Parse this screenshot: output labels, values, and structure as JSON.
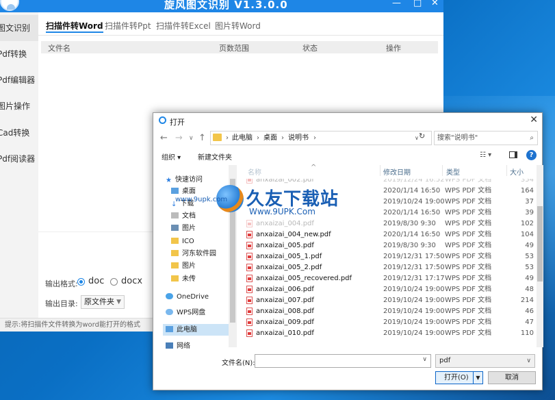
{
  "app": {
    "title": "旋风图文识别 V1.3.0.0",
    "window_controls": [
      "—",
      "□",
      "✕"
    ],
    "sidebar": [
      "图文识别",
      "Pdf转换",
      "Pdf编辑器",
      "图片操作",
      "Cad转换",
      "Pdf阅读器"
    ],
    "tabs": [
      "扫描件转Word",
      "扫描件转Ppt",
      "扫描件转Excel",
      "图片转Word"
    ],
    "table_headers": [
      "文件名",
      "页数范围",
      "状态",
      "操作"
    ],
    "output_format_label": "输出格式:",
    "format_options": [
      "doc",
      "docx"
    ],
    "selected_format": "doc",
    "output_dir_label": "输出目录:",
    "output_dir_value": "原文件夹",
    "status_text": "提示:将扫描件文件转换为word能打开的格式"
  },
  "dialog": {
    "title": "打开",
    "path": [
      "此电脑",
      "桌面",
      "说明书"
    ],
    "search_placeholder": "搜索\"说明书\"",
    "toolbar": {
      "organize": "组织 ▾",
      "new_folder": "新建文件夹"
    },
    "nav_items": [
      {
        "label": "快速访问",
        "icon": "star-icon"
      },
      {
        "label": "桌面",
        "icon": "folder-icon"
      },
      {
        "label": "下载",
        "icon": "download-icon"
      },
      {
        "label": "文档",
        "icon": "folder-icon"
      },
      {
        "label": "图片",
        "icon": "folder-icon"
      },
      {
        "label": "ICO",
        "icon": "folder-icon"
      },
      {
        "label": "河东软件园",
        "icon": "folder-icon"
      },
      {
        "label": "图片",
        "icon": "folder-icon"
      },
      {
        "label": "未传",
        "icon": "folder-icon"
      },
      {
        "label": "OneDrive",
        "icon": "cloud-icon"
      },
      {
        "label": "WPS网盘",
        "icon": "cloud-icon"
      },
      {
        "label": "此电脑",
        "icon": "pc-icon"
      },
      {
        "label": "网络",
        "icon": "network-icon"
      }
    ],
    "columns": [
      "名称",
      "修改日期",
      "类型",
      "大小"
    ],
    "files": [
      {
        "name": "anxaizai_002.pdf",
        "date": "2019/12/24 16:52",
        "type": "WPS PDF 文档",
        "size": "354",
        "faded": true
      },
      {
        "name": "anxaizai_003.pdf",
        "date": "2020/1/14 16:50",
        "type": "WPS PDF 文档",
        "size": "164",
        "faded": true
      },
      {
        "name": "anxaizai_003_1.pdf",
        "date": "2019/10/24 19:00",
        "type": "WPS PDF 文档",
        "size": "37",
        "faded": true
      },
      {
        "name": "anxaizai_004.pdf",
        "date": "2020/1/14 16:50",
        "type": "WPS PDF 文档",
        "size": "39",
        "faded": true
      },
      {
        "name": "anxaizai_004.pdf",
        "date": "2019/8/30 9:30",
        "type": "WPS PDF 文档",
        "size": "102",
        "faded": true
      },
      {
        "name": "anxaizai_004_new.pdf",
        "date": "2020/1/14 16:50",
        "type": "WPS PDF 文档",
        "size": "104",
        "faded": false
      },
      {
        "name": "anxaizai_005.pdf",
        "date": "2019/8/30 9:30",
        "type": "WPS PDF 文档",
        "size": "49",
        "faded": false
      },
      {
        "name": "anxaizai_005_1.pdf",
        "date": "2019/12/31 17:50",
        "type": "WPS PDF 文档",
        "size": "53",
        "faded": false
      },
      {
        "name": "anxaizai_005_2.pdf",
        "date": "2019/12/31 17:50",
        "type": "WPS PDF 文档",
        "size": "53",
        "faded": false
      },
      {
        "name": "anxaizai_005_recovered.pdf",
        "date": "2019/12/31 17:17",
        "type": "WPS PDF 文档",
        "size": "49",
        "faded": false
      },
      {
        "name": "anxaizai_006.pdf",
        "date": "2019/10/24 19:00",
        "type": "WPS PDF 文档",
        "size": "48",
        "faded": false
      },
      {
        "name": "anxaizai_007.pdf",
        "date": "2019/10/24 19:00",
        "type": "WPS PDF 文档",
        "size": "214",
        "faded": false
      },
      {
        "name": "anxaizai_008.pdf",
        "date": "2019/10/24 19:00",
        "type": "WPS PDF 文档",
        "size": "46",
        "faded": false
      },
      {
        "name": "anxaizai_009.pdf",
        "date": "2019/10/24 19:00",
        "type": "WPS PDF 文档",
        "size": "47",
        "faded": false
      },
      {
        "name": "anxaizai_010.pdf",
        "date": "2019/10/24 19:00",
        "type": "WPS PDF 文档",
        "size": "110",
        "faded": false
      }
    ],
    "filename_label": "文件名(N):",
    "filename_value": "",
    "file_type": "pdf",
    "open_button": "打开(O)",
    "cancel_button": "取消"
  },
  "watermark": {
    "brand": "久友下载站",
    "url": "Www.9UPK.Com",
    "small": "www.9upk.com"
  },
  "colors": {
    "accent": "#1e86e6",
    "desktop": "#0a6fc4",
    "pdf_icon": "#e03a3a"
  }
}
